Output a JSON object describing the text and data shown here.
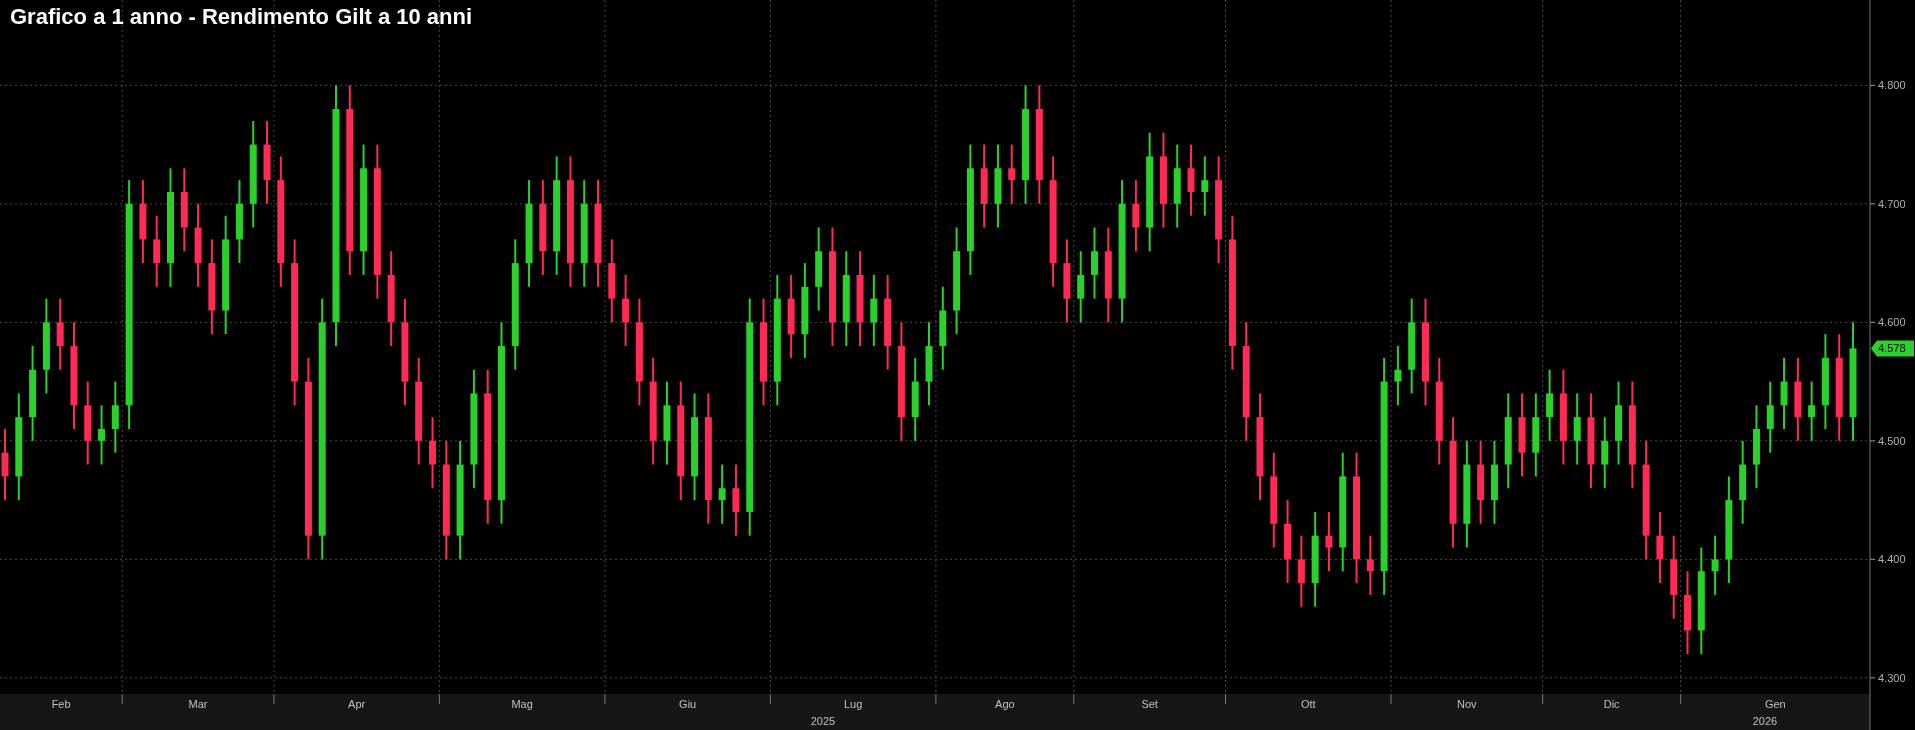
{
  "title": "Grafico a 1 anno - Rendimento Gilt a 10 anni",
  "chart": {
    "last_value_label": "4.578",
    "year_labels": [
      "2025",
      "2026"
    ],
    "month_labels": [
      "Feb",
      "Mar",
      "Apr",
      "Mag",
      "Giu",
      "Lug",
      "Ago",
      "Set",
      "Ott",
      "Nov",
      "Dic",
      "Gen"
    ],
    "chart_data": {
      "type": "candlestick",
      "ylim": [
        4.256,
        4.872
      ],
      "grid": true,
      "yticks": [
        {
          "value": 4.3,
          "label": "4.300"
        },
        {
          "value": 4.4,
          "label": "4.400"
        },
        {
          "value": 4.5,
          "label": "4.500"
        },
        {
          "value": 4.6,
          "label": "4.600"
        },
        {
          "value": 4.7,
          "label": "4.700"
        },
        {
          "value": 4.8,
          "label": "4.800"
        }
      ],
      "ohlc": [
        [
          4.49,
          4.51,
          4.45,
          4.47
        ],
        [
          4.47,
          4.54,
          4.45,
          4.52
        ],
        [
          4.52,
          4.58,
          4.5,
          4.56
        ],
        [
          4.56,
          4.62,
          4.54,
          4.6
        ],
        [
          4.6,
          4.62,
          4.56,
          4.58
        ],
        [
          4.58,
          4.6,
          4.51,
          4.53
        ],
        [
          4.53,
          4.55,
          4.48,
          4.5
        ],
        [
          4.5,
          4.53,
          4.48,
          4.51
        ],
        [
          4.51,
          4.55,
          4.49,
          4.53
        ],
        [
          4.53,
          4.72,
          4.51,
          4.7
        ],
        [
          4.7,
          4.72,
          4.65,
          4.67
        ],
        [
          4.67,
          4.69,
          4.63,
          4.65
        ],
        [
          4.65,
          4.73,
          4.63,
          4.71
        ],
        [
          4.71,
          4.73,
          4.66,
          4.68
        ],
        [
          4.68,
          4.7,
          4.63,
          4.65
        ],
        [
          4.65,
          4.67,
          4.59,
          4.61
        ],
        [
          4.61,
          4.69,
          4.59,
          4.67
        ],
        [
          4.67,
          4.72,
          4.65,
          4.7
        ],
        [
          4.7,
          4.77,
          4.68,
          4.75
        ],
        [
          4.75,
          4.77,
          4.7,
          4.72
        ],
        [
          4.72,
          4.74,
          4.63,
          4.65
        ],
        [
          4.65,
          4.67,
          4.53,
          4.55
        ],
        [
          4.55,
          4.57,
          4.4,
          4.42
        ],
        [
          4.42,
          4.62,
          4.4,
          4.6
        ],
        [
          4.6,
          4.8,
          4.58,
          4.78
        ],
        [
          4.78,
          4.8,
          4.64,
          4.66
        ],
        [
          4.66,
          4.75,
          4.64,
          4.73
        ],
        [
          4.73,
          4.75,
          4.62,
          4.64
        ],
        [
          4.64,
          4.66,
          4.58,
          4.6
        ],
        [
          4.6,
          4.62,
          4.53,
          4.55
        ],
        [
          4.55,
          4.57,
          4.48,
          4.5
        ],
        [
          4.5,
          4.52,
          4.46,
          4.48
        ],
        [
          4.48,
          4.5,
          4.4,
          4.42
        ],
        [
          4.42,
          4.5,
          4.4,
          4.48
        ],
        [
          4.48,
          4.56,
          4.46,
          4.54
        ],
        [
          4.54,
          4.56,
          4.43,
          4.45
        ],
        [
          4.45,
          4.6,
          4.43,
          4.58
        ],
        [
          4.58,
          4.67,
          4.56,
          4.65
        ],
        [
          4.65,
          4.72,
          4.63,
          4.7
        ],
        [
          4.7,
          4.72,
          4.64,
          4.66
        ],
        [
          4.66,
          4.74,
          4.64,
          4.72
        ],
        [
          4.72,
          4.74,
          4.63,
          4.65
        ],
        [
          4.65,
          4.72,
          4.63,
          4.7
        ],
        [
          4.7,
          4.72,
          4.63,
          4.65
        ],
        [
          4.65,
          4.67,
          4.6,
          4.62
        ],
        [
          4.62,
          4.64,
          4.58,
          4.6
        ],
        [
          4.6,
          4.62,
          4.53,
          4.55
        ],
        [
          4.55,
          4.57,
          4.48,
          4.5
        ],
        [
          4.5,
          4.55,
          4.48,
          4.53
        ],
        [
          4.53,
          4.55,
          4.45,
          4.47
        ],
        [
          4.47,
          4.54,
          4.45,
          4.52
        ],
        [
          4.52,
          4.54,
          4.43,
          4.45
        ],
        [
          4.45,
          4.48,
          4.43,
          4.46
        ],
        [
          4.46,
          4.48,
          4.42,
          4.44
        ],
        [
          4.44,
          4.62,
          4.42,
          4.6
        ],
        [
          4.6,
          4.62,
          4.53,
          4.55
        ],
        [
          4.55,
          4.64,
          4.53,
          4.62
        ],
        [
          4.62,
          4.64,
          4.57,
          4.59
        ],
        [
          4.59,
          4.65,
          4.57,
          4.63
        ],
        [
          4.63,
          4.68,
          4.61,
          4.66
        ],
        [
          4.66,
          4.68,
          4.58,
          4.6
        ],
        [
          4.6,
          4.66,
          4.58,
          4.64
        ],
        [
          4.64,
          4.66,
          4.58,
          4.6
        ],
        [
          4.6,
          4.64,
          4.58,
          4.62
        ],
        [
          4.62,
          4.64,
          4.56,
          4.58
        ],
        [
          4.58,
          4.6,
          4.5,
          4.52
        ],
        [
          4.52,
          4.57,
          4.5,
          4.55
        ],
        [
          4.55,
          4.6,
          4.53,
          4.58
        ],
        [
          4.58,
          4.63,
          4.56,
          4.61
        ],
        [
          4.61,
          4.68,
          4.59,
          4.66
        ],
        [
          4.66,
          4.75,
          4.64,
          4.73
        ],
        [
          4.73,
          4.75,
          4.68,
          4.7
        ],
        [
          4.7,
          4.75,
          4.68,
          4.73
        ],
        [
          4.73,
          4.75,
          4.7,
          4.72
        ],
        [
          4.72,
          4.8,
          4.7,
          4.78
        ],
        [
          4.78,
          4.8,
          4.7,
          4.72
        ],
        [
          4.72,
          4.74,
          4.63,
          4.65
        ],
        [
          4.65,
          4.67,
          4.6,
          4.62
        ],
        [
          4.62,
          4.66,
          4.6,
          4.64
        ],
        [
          4.64,
          4.68,
          4.62,
          4.66
        ],
        [
          4.66,
          4.68,
          4.6,
          4.62
        ],
        [
          4.62,
          4.72,
          4.6,
          4.7
        ],
        [
          4.7,
          4.72,
          4.66,
          4.68
        ],
        [
          4.68,
          4.76,
          4.66,
          4.74
        ],
        [
          4.74,
          4.76,
          4.68,
          4.7
        ],
        [
          4.7,
          4.75,
          4.68,
          4.73
        ],
        [
          4.73,
          4.75,
          4.69,
          4.71
        ],
        [
          4.71,
          4.74,
          4.69,
          4.72
        ],
        [
          4.72,
          4.74,
          4.65,
          4.67
        ],
        [
          4.67,
          4.69,
          4.56,
          4.58
        ],
        [
          4.58,
          4.6,
          4.5,
          4.52
        ],
        [
          4.52,
          4.54,
          4.45,
          4.47
        ],
        [
          4.47,
          4.49,
          4.41,
          4.43
        ],
        [
          4.43,
          4.45,
          4.38,
          4.4
        ],
        [
          4.4,
          4.42,
          4.36,
          4.38
        ],
        [
          4.38,
          4.44,
          4.36,
          4.42
        ],
        [
          4.42,
          4.44,
          4.39,
          4.41
        ],
        [
          4.41,
          4.49,
          4.39,
          4.47
        ],
        [
          4.47,
          4.49,
          4.38,
          4.4
        ],
        [
          4.4,
          4.42,
          4.37,
          4.39
        ],
        [
          4.39,
          4.57,
          4.37,
          4.55
        ],
        [
          4.55,
          4.58,
          4.53,
          4.56
        ],
        [
          4.56,
          4.62,
          4.54,
          4.6
        ],
        [
          4.6,
          4.62,
          4.53,
          4.55
        ],
        [
          4.55,
          4.57,
          4.48,
          4.5
        ],
        [
          4.5,
          4.52,
          4.41,
          4.43
        ],
        [
          4.43,
          4.5,
          4.41,
          4.48
        ],
        [
          4.48,
          4.5,
          4.43,
          4.45
        ],
        [
          4.45,
          4.5,
          4.43,
          4.48
        ],
        [
          4.48,
          4.54,
          4.46,
          4.52
        ],
        [
          4.52,
          4.54,
          4.47,
          4.49
        ],
        [
          4.49,
          4.54,
          4.47,
          4.52
        ],
        [
          4.52,
          4.56,
          4.5,
          4.54
        ],
        [
          4.54,
          4.56,
          4.48,
          4.5
        ],
        [
          4.5,
          4.54,
          4.48,
          4.52
        ],
        [
          4.52,
          4.54,
          4.46,
          4.48
        ],
        [
          4.48,
          4.52,
          4.46,
          4.5
        ],
        [
          4.5,
          4.55,
          4.48,
          4.53
        ],
        [
          4.53,
          4.55,
          4.46,
          4.48
        ],
        [
          4.48,
          4.5,
          4.4,
          4.42
        ],
        [
          4.42,
          4.44,
          4.38,
          4.4
        ],
        [
          4.4,
          4.42,
          4.35,
          4.37
        ],
        [
          4.37,
          4.39,
          4.32,
          4.34
        ],
        [
          4.34,
          4.41,
          4.32,
          4.39
        ],
        [
          4.39,
          4.42,
          4.37,
          4.4
        ],
        [
          4.4,
          4.47,
          4.38,
          4.45
        ],
        [
          4.45,
          4.5,
          4.43,
          4.48
        ],
        [
          4.48,
          4.53,
          4.46,
          4.51
        ],
        [
          4.51,
          4.55,
          4.49,
          4.53
        ],
        [
          4.53,
          4.57,
          4.51,
          4.55
        ],
        [
          4.55,
          4.57,
          4.5,
          4.52
        ],
        [
          4.52,
          4.55,
          4.5,
          4.53
        ],
        [
          4.53,
          4.59,
          4.51,
          4.57
        ],
        [
          4.57,
          4.59,
          4.5,
          4.52
        ],
        [
          4.52,
          4.6,
          4.5,
          4.578
        ]
      ]
    }
  }
}
